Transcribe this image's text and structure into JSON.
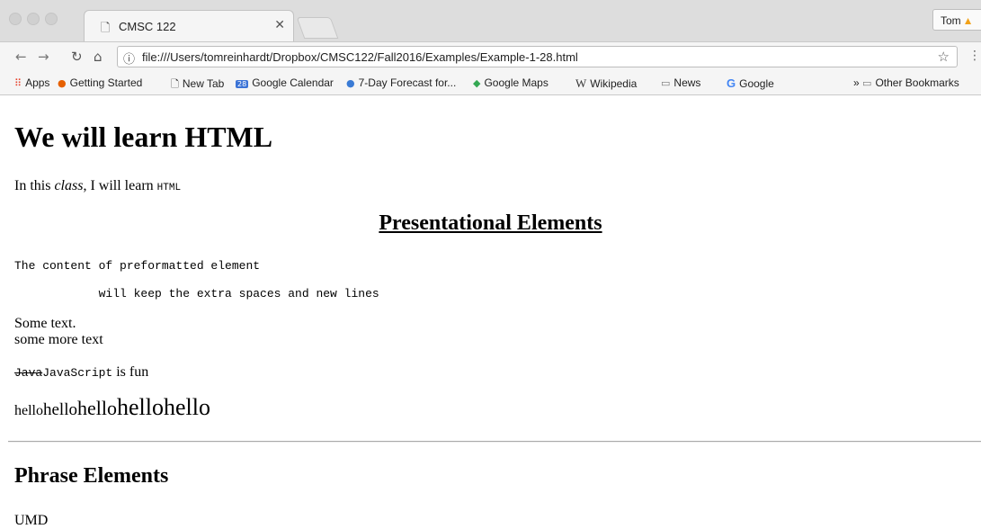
{
  "browser": {
    "tab_title": "CMSC 122",
    "profile_name": "Tom",
    "url": "file:///Users/tomreinhardt/Dropbox/CMSC122/Fall2016/Examples/Example-1-28.html",
    "bookmarks": [
      {
        "label": "Apps",
        "icon": "apps-grid-icon"
      },
      {
        "label": "Getting Started",
        "icon": "firefox-icon"
      },
      {
        "label": "New Tab",
        "icon": "page-icon"
      },
      {
        "label": "Google Calendar",
        "icon": "calendar-icon",
        "icon_text": "28"
      },
      {
        "label": "7-Day Forecast for...",
        "icon": "weather-icon"
      },
      {
        "label": "Google Maps",
        "icon": "maps-icon"
      },
      {
        "label": "Wikipedia",
        "icon": "wikipedia-icon",
        "icon_text": "W"
      },
      {
        "label": "News",
        "icon": "folder-icon"
      },
      {
        "label": "Google",
        "icon": "google-icon",
        "icon_text": "G"
      }
    ],
    "other_bookmarks": "Other Bookmarks",
    "overflow_chevron": "»",
    "colors": {
      "chrome_bg": "#f5f5f5",
      "tabstrip_bg": "#dddddd",
      "warning": "#f2a21a"
    }
  },
  "page": {
    "heading": "We will learn HTML",
    "intro": {
      "prefix": "In this ",
      "em": "class",
      "middle": ", I will learn ",
      "code": "HTML"
    },
    "presentational_heading": "Presentational Elements",
    "pre_line1": "The content of preformatted element",
    "pre_line2": "            will keep the extra spaces and new lines",
    "some_text": "Some text.",
    "some_more_text": "some more text",
    "strike_text": "Java",
    "code_text": "JavaScript",
    "fun_text": " is fun",
    "hello_words": [
      "hello",
      "hello",
      "hello",
      "hello",
      "hello"
    ],
    "phrase_heading": "Phrase Elements",
    "umd": "UMD"
  }
}
